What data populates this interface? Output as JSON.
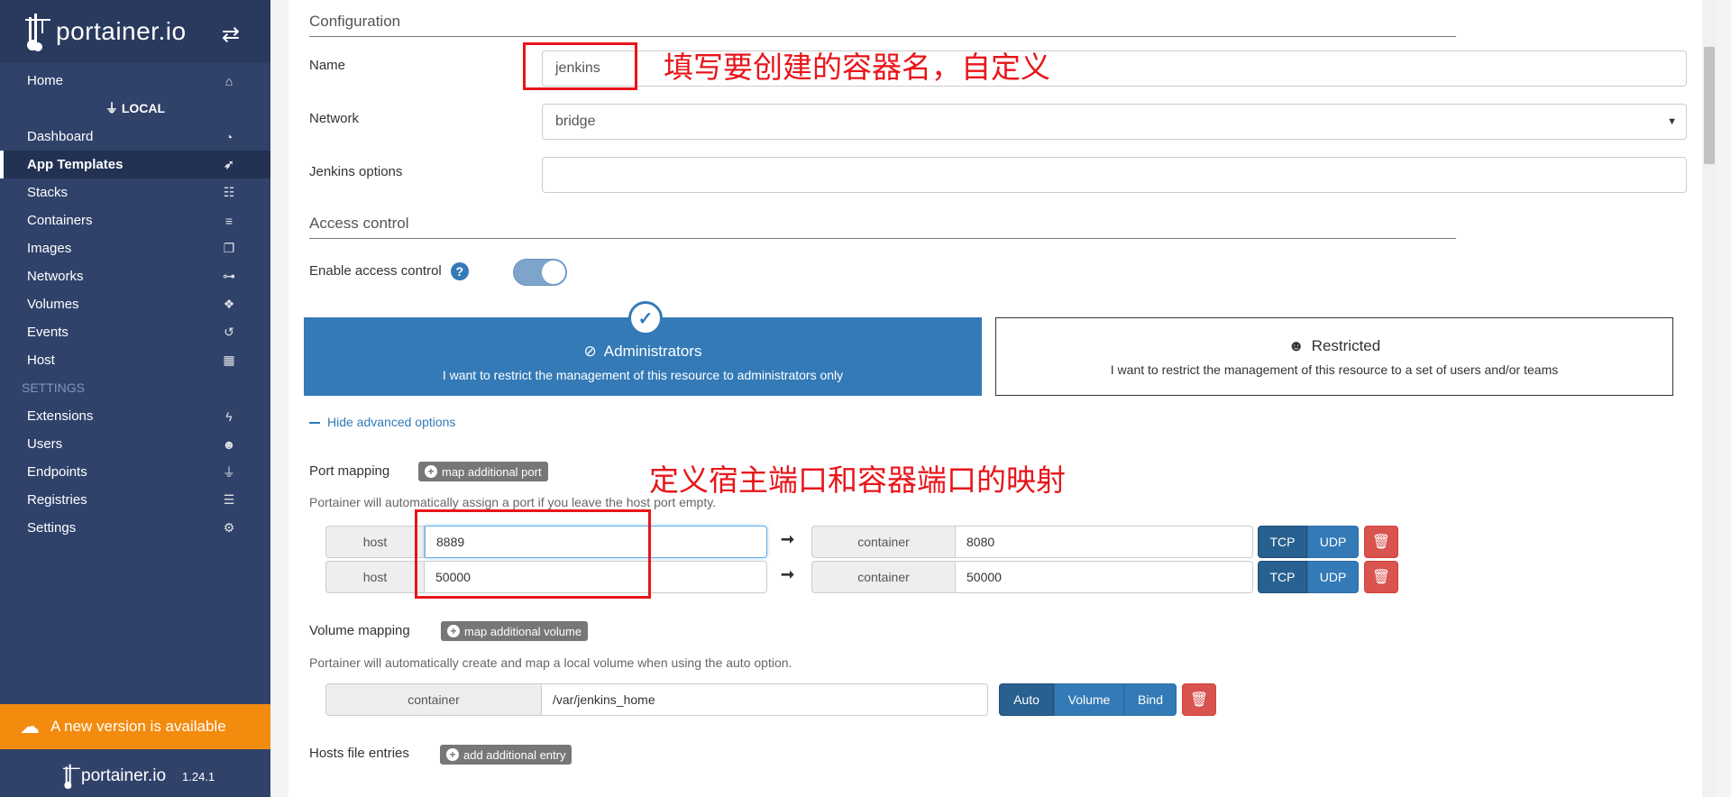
{
  "sidebar": {
    "brand": "portainer.io",
    "items": [
      {
        "label": "Home",
        "icon": "home-icon",
        "glyph": "⌂"
      },
      {
        "label": "Dashboard",
        "icon": "tachometer-icon",
        "glyph": "◔"
      },
      {
        "label": "App Templates",
        "icon": "rocket-icon",
        "glyph": "➶"
      },
      {
        "label": "Stacks",
        "icon": "th-list-icon",
        "glyph": "☷"
      },
      {
        "label": "Containers",
        "icon": "server-icon",
        "glyph": "≡"
      },
      {
        "label": "Images",
        "icon": "clone-icon",
        "glyph": "❐"
      },
      {
        "label": "Networks",
        "icon": "sitemap-icon",
        "glyph": "⊶"
      },
      {
        "label": "Volumes",
        "icon": "cubes-icon",
        "glyph": "❖"
      },
      {
        "label": "Events",
        "icon": "history-icon",
        "glyph": "↺"
      },
      {
        "label": "Host",
        "icon": "th-icon",
        "glyph": "▦"
      }
    ],
    "endpoint_label": "LOCAL",
    "settings_header": "SETTINGS",
    "settings_items": [
      {
        "label": "Extensions",
        "icon": "bolt-icon",
        "glyph": "ϟ"
      },
      {
        "label": "Users",
        "icon": "users-icon",
        "glyph": "☻"
      },
      {
        "label": "Endpoints",
        "icon": "plug-icon",
        "glyph": "⏚"
      },
      {
        "label": "Registries",
        "icon": "database-icon",
        "glyph": "☰"
      },
      {
        "label": "Settings",
        "icon": "cogs-icon",
        "glyph": "⚙"
      }
    ],
    "update_banner": "A new version is available",
    "footer_brand": "portainer.io",
    "version": "1.24.1"
  },
  "configuration": {
    "title": "Configuration",
    "name_label": "Name",
    "name_value": "jenkins",
    "network_label": "Network",
    "network_value": "bridge",
    "options_label": "Jenkins options",
    "options_value": ""
  },
  "access_control": {
    "title": "Access control",
    "enable_label": "Enable access control",
    "enabled": true,
    "admin_title": "Administrators",
    "admin_desc": "I want to restrict the management of this resource to administrators only",
    "restricted_title": "Restricted",
    "restricted_desc": "I want to restrict the management of this resource to a set of users and/or teams"
  },
  "advanced": {
    "toggle_label": "Hide advanced options",
    "port_mapping_label": "Port mapping",
    "port_add_button": "map additional port",
    "port_help": "Portainer will automatically assign a port if you leave the host port empty.",
    "ports": [
      {
        "host_label": "host",
        "host_value": "8889",
        "container_label": "container",
        "container_value": "8080",
        "protocol": "TCP"
      },
      {
        "host_label": "host",
        "host_value": "50000",
        "container_label": "container",
        "container_value": "50000",
        "protocol": "TCP"
      }
    ],
    "protocol_options": [
      "TCP",
      "UDP"
    ],
    "volume_mapping_label": "Volume mapping",
    "volume_add_button": "map additional volume",
    "volume_help": "Portainer will automatically create and map a local volume when using the auto option.",
    "volume": {
      "container_label": "container",
      "container_value": "/var/jenkins_home",
      "mode": "Auto"
    },
    "volume_options": [
      "Auto",
      "Volume",
      "Bind"
    ],
    "hosts_label": "Hosts file entries",
    "hosts_add_button": "add additional entry"
  },
  "annotations": {
    "name_note": "填写要创建的容器名，自定义",
    "port_note": "定义宿主端口和容器端口的映射"
  },
  "colors": {
    "sidebar_bg": "#30426a",
    "primary": "#337ab7",
    "danger": "#d9534f",
    "warning": "#f38b0f",
    "annotation_red": "#e8151a"
  }
}
